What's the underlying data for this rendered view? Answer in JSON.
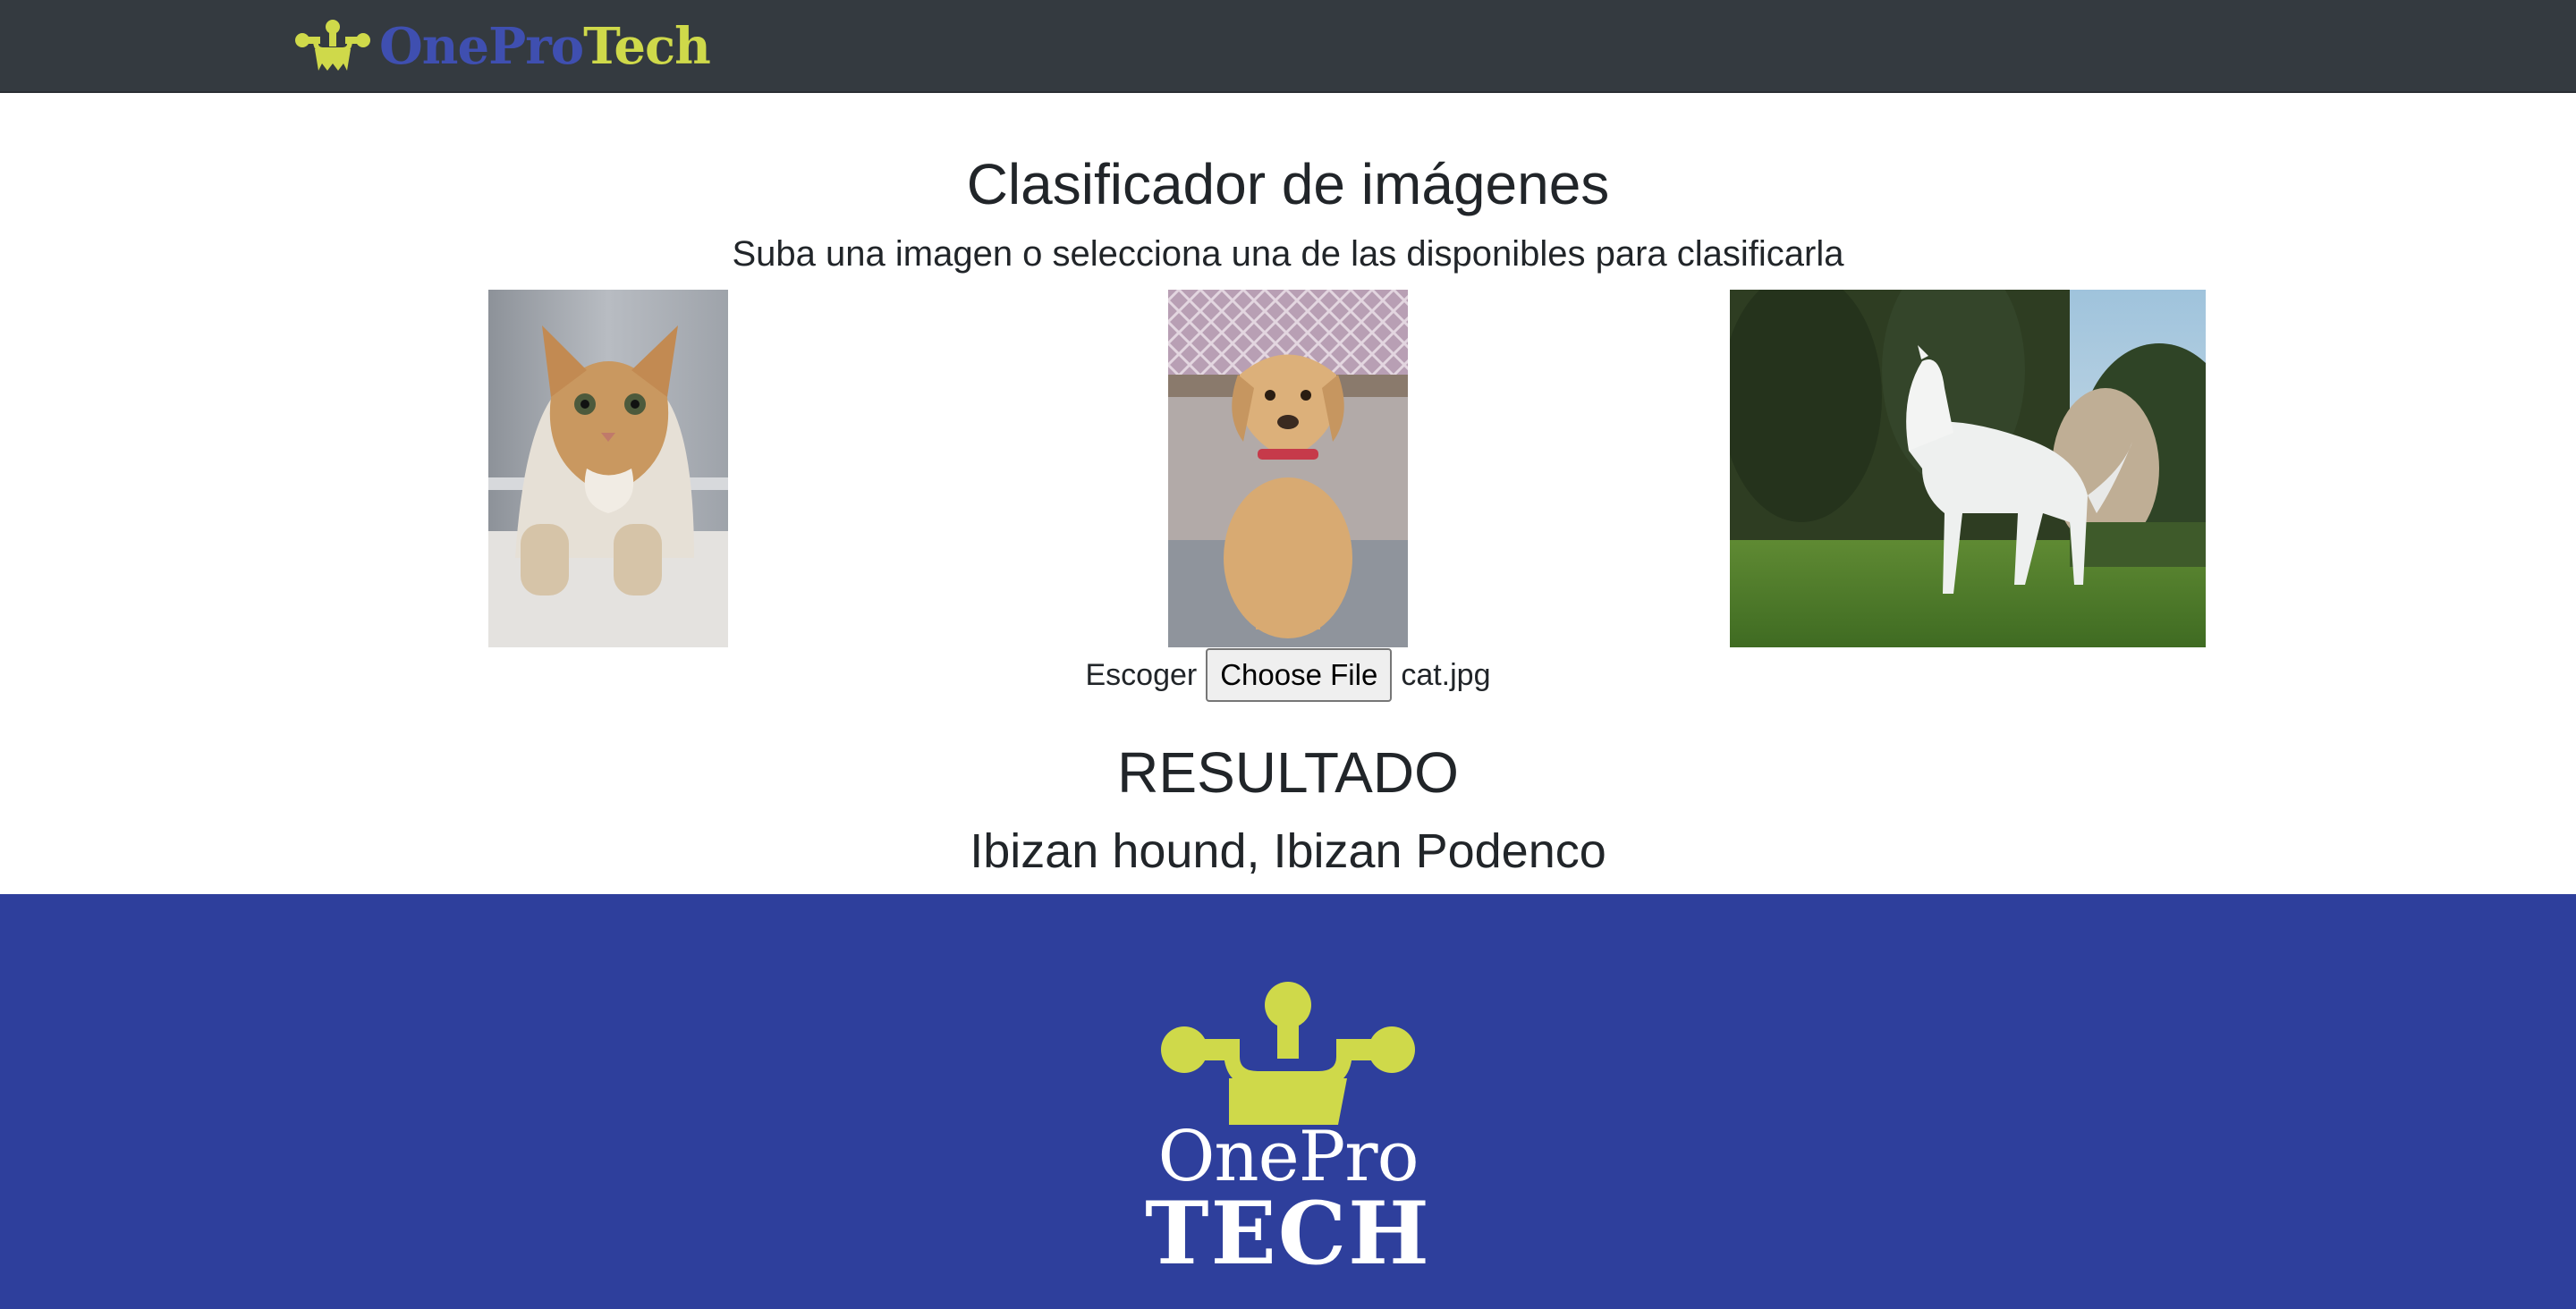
{
  "navbar": {
    "brand": {
      "part1": "OnePro",
      "part2": "Tech",
      "logo_icon": "circuit-tree-icon"
    }
  },
  "main": {
    "title": "Clasificador de imágenes",
    "subtitle": "Suba una imagen o selecciona una de las disponibles para clasificarla",
    "sample_images": [
      {
        "subject": "cat"
      },
      {
        "subject": "dog"
      },
      {
        "subject": "horse"
      }
    ],
    "upload": {
      "label": "Escoger",
      "button_label": "Choose File",
      "file_name": "cat.jpg"
    },
    "result": {
      "heading": "RESULTADO",
      "value": "Ibizan hound, Ibizan Podenco"
    }
  },
  "footer": {
    "logo": {
      "line1": "OnePro",
      "line2": "TECH",
      "logo_icon": "circuit-tree-icon"
    }
  },
  "colors": {
    "navbar_bg": "#343a40",
    "brand_blue": "#3f4fb0",
    "brand_lime": "#cfd94a",
    "footer_bg": "#2e3f9c"
  }
}
